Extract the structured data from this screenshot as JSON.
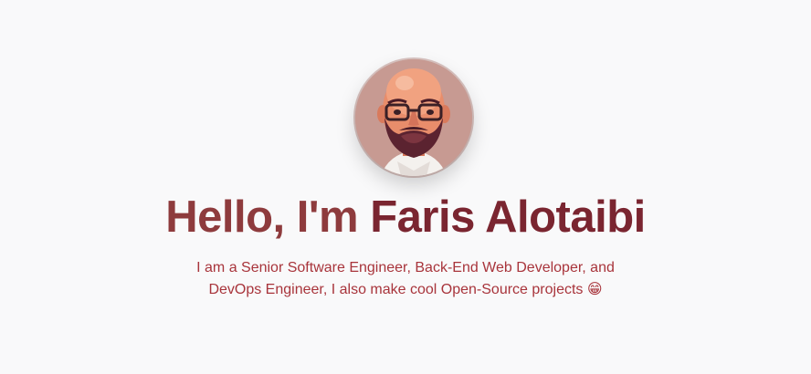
{
  "hero": {
    "greeting": "Hello, I'm ",
    "name": "Faris Alotaibi",
    "bio_line_1": "I am a Senior Software Engineer, Back-End Web Developer, and",
    "bio_line_2": "DevOps Engineer, I also make cool Open-Source projects",
    "emoji": "😁",
    "avatar_icon": "profile-portrait"
  },
  "colors": {
    "background": "#f9f9fa",
    "title": "#8e3b3d",
    "subtitle": "#a8343b"
  }
}
